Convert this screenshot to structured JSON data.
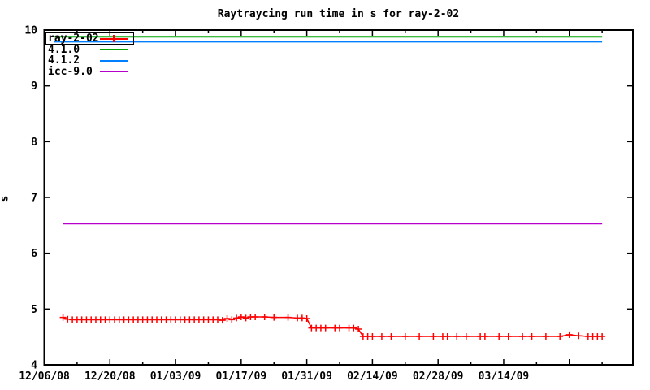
{
  "chart_data": {
    "type": "line",
    "title": "Raytraycing run time in s for ray-2-02",
    "xlabel": "",
    "ylabel": "s",
    "ylim": [
      4,
      10
    ],
    "grid": false,
    "legend_position": "top-left",
    "x_unit": "days since 12/06/2008",
    "xlim_days": [
      0,
      125.6
    ],
    "yticks": [
      4,
      5,
      6,
      7,
      8,
      9,
      10
    ],
    "xticks_major": [
      {
        "day": 0,
        "label": "12/06/08"
      },
      {
        "day": 14,
        "label": "12/20/08"
      },
      {
        "day": 28,
        "label": "01/03/09"
      },
      {
        "day": 42,
        "label": "01/17/09"
      },
      {
        "day": 56,
        "label": "01/31/09"
      },
      {
        "day": 70,
        "label": "02/14/09"
      },
      {
        "day": 84,
        "label": "02/28/09"
      },
      {
        "day": 98,
        "label": "03/14/09"
      },
      {
        "day": 112,
        "label": ""
      }
    ],
    "xticks_minor_days": [
      7,
      21,
      35,
      49,
      63,
      77,
      91,
      105,
      119
    ],
    "axis_color": "#000000",
    "background_color": "#ffffff",
    "series": [
      {
        "name": "ray-2-02",
        "type": "points+line",
        "marker": "+",
        "color": "#ff0000",
        "points": [
          [
            4,
            4.85
          ],
          [
            5,
            4.82
          ],
          [
            6,
            4.81
          ],
          [
            7,
            4.81
          ],
          [
            8,
            4.81
          ],
          [
            9,
            4.81
          ],
          [
            10,
            4.81
          ],
          [
            11,
            4.81
          ],
          [
            12,
            4.81
          ],
          [
            13,
            4.81
          ],
          [
            14,
            4.81
          ],
          [
            15,
            4.81
          ],
          [
            16,
            4.81
          ],
          [
            17,
            4.81
          ],
          [
            18,
            4.81
          ],
          [
            19,
            4.81
          ],
          [
            20,
            4.81
          ],
          [
            21,
            4.81
          ],
          [
            22,
            4.81
          ],
          [
            23,
            4.81
          ],
          [
            24,
            4.81
          ],
          [
            25,
            4.81
          ],
          [
            26,
            4.81
          ],
          [
            27,
            4.81
          ],
          [
            28,
            4.81
          ],
          [
            29,
            4.81
          ],
          [
            30,
            4.81
          ],
          [
            31,
            4.81
          ],
          [
            32,
            4.81
          ],
          [
            33,
            4.81
          ],
          [
            34,
            4.81
          ],
          [
            35,
            4.81
          ],
          [
            36,
            4.81
          ],
          [
            37,
            4.81
          ],
          [
            38,
            4.8
          ],
          [
            39,
            4.83
          ],
          [
            40,
            4.81
          ],
          [
            41,
            4.84
          ],
          [
            42,
            4.86
          ],
          [
            43,
            4.84
          ],
          [
            44,
            4.86
          ],
          [
            45,
            4.86
          ],
          [
            47,
            4.86
          ],
          [
            49,
            4.85
          ],
          [
            52,
            4.85
          ],
          [
            54,
            4.84
          ],
          [
            55,
            4.84
          ],
          [
            56,
            4.83
          ],
          [
            57,
            4.66
          ],
          [
            58,
            4.66
          ],
          [
            59,
            4.66
          ],
          [
            60,
            4.66
          ],
          [
            62,
            4.66
          ],
          [
            63,
            4.66
          ],
          [
            65,
            4.66
          ],
          [
            66,
            4.66
          ],
          [
            67,
            4.64
          ],
          [
            68,
            4.51
          ],
          [
            69,
            4.51
          ],
          [
            70,
            4.51
          ],
          [
            72,
            4.51
          ],
          [
            74,
            4.51
          ],
          [
            77,
            4.51
          ],
          [
            80,
            4.51
          ],
          [
            83,
            4.51
          ],
          [
            85,
            4.51
          ],
          [
            86,
            4.51
          ],
          [
            88,
            4.51
          ],
          [
            90,
            4.51
          ],
          [
            93,
            4.51
          ],
          [
            94,
            4.51
          ],
          [
            97,
            4.51
          ],
          [
            99,
            4.51
          ],
          [
            102,
            4.51
          ],
          [
            104,
            4.51
          ],
          [
            107,
            4.51
          ],
          [
            110,
            4.51
          ],
          [
            112,
            4.54
          ],
          [
            114,
            4.52
          ],
          [
            116,
            4.51
          ],
          [
            117,
            4.51
          ],
          [
            118,
            4.51
          ],
          [
            119,
            4.51
          ]
        ]
      },
      {
        "name": "4.1.0",
        "type": "hline",
        "color": "#00a500",
        "value": 9.88,
        "day_start": 2,
        "day_end": 119
      },
      {
        "name": "4.1.2",
        "type": "hline",
        "color": "#0080ff",
        "value": 9.79,
        "day_start": 2,
        "day_end": 119
      },
      {
        "name": "icc-9.0",
        "type": "hline",
        "color": "#b800cc",
        "value": 6.53,
        "day_start": 4,
        "day_end": 119
      }
    ]
  }
}
